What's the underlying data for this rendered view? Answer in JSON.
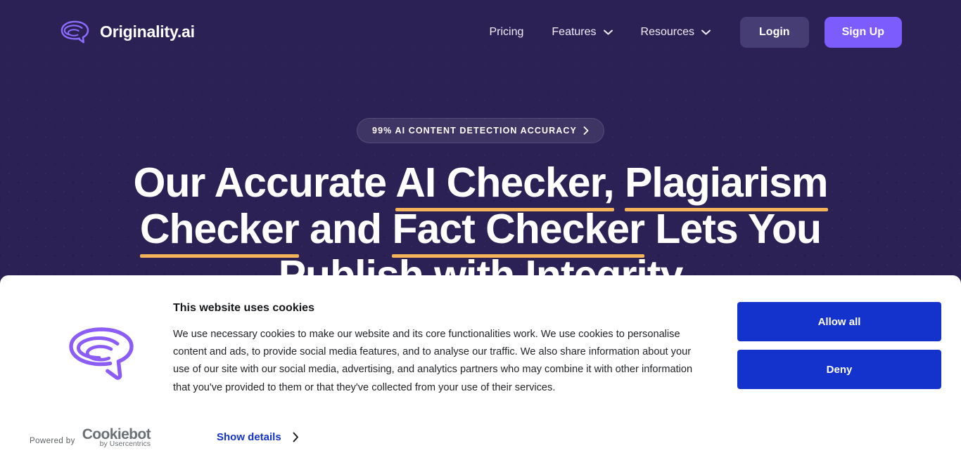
{
  "header": {
    "brand_name": "Originality.ai",
    "brand_logo_icon": "brain-spiral-icon",
    "nav": [
      {
        "label": "Pricing",
        "has_chevron": false,
        "icon": ""
      },
      {
        "label": "Features",
        "has_chevron": true,
        "icon": "chevron-down-icon"
      },
      {
        "label": "Resources",
        "has_chevron": true,
        "icon": "chevron-down-icon"
      }
    ],
    "login_label": "Login",
    "signup_label": "Sign Up"
  },
  "hero": {
    "badge_text": "99% AI CONTENT DETECTION ACCURACY",
    "badge_icon": "chevron-right-icon",
    "headline_parts": [
      {
        "text": "Our Accurate ",
        "underlined": false
      },
      {
        "text": "AI Checker,",
        "underlined": true
      },
      {
        "text": " ",
        "underlined": false
      },
      {
        "text": "Plagiarism Checker",
        "underlined": true
      },
      {
        "text": " and ",
        "underlined": false
      },
      {
        "text": "Fact Checker",
        "underlined": true
      },
      {
        "text": " Lets You Publish with Integrity",
        "underlined": false
      }
    ],
    "headline_line1_a": "Our Accurate ",
    "headline_line1_b": "AI Checker,",
    "headline_line1_c": "Plagiarism",
    "headline_line2_a": "Checker",
    "headline_line2_b": " and ",
    "headline_line2_c": "Fact Checker",
    "headline_line2_d": " Lets You",
    "headline_line3": "Publish with Integrity"
  },
  "cookie_banner": {
    "logo_icon": "brain-spiral-icon",
    "title": "This website uses cookies",
    "body": "We use necessary cookies to make our website and its core functionalities work. We use cookies to personalise content and ads, to provide social media features, and to analyse our traffic. We also share information about your use of our site with our social media, advertising, and analytics partners who may combine it with other information that you've provided to them or that they've collected from your use of their services.",
    "allow_all_label": "Allow all",
    "deny_label": "Deny",
    "powered_by_label": "Powered by",
    "cookiebot_name": "Cookiebot",
    "cookiebot_sub": "by Usercentrics",
    "show_details_label": "Show details",
    "show_details_icon": "chevron-right-icon"
  },
  "colors": {
    "page_bg": "#2b2155",
    "accent_violet": "#7c5cfc",
    "login_bg": "#473d75",
    "underline_orange": "#f5b45a",
    "cookie_blue": "#1433cc",
    "cookie_bg": "#ffffff"
  }
}
